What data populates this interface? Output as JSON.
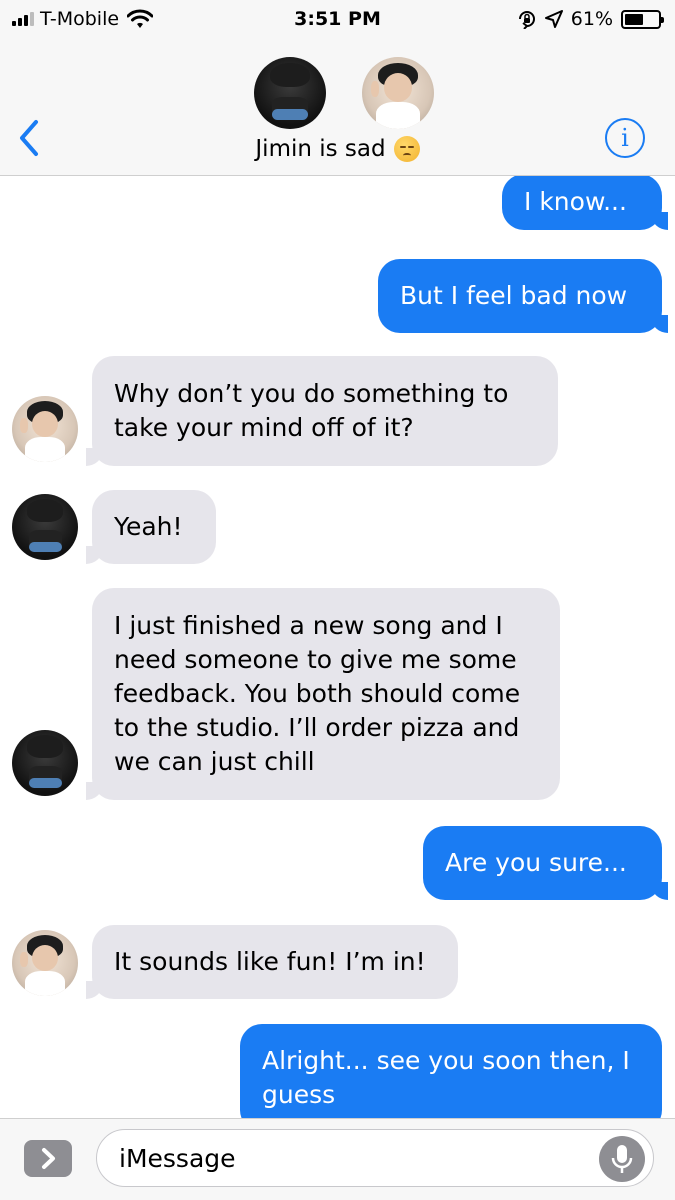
{
  "status_bar": {
    "carrier": "T-Mobile",
    "time": "3:51 PM",
    "battery": "61%",
    "battery_level": 0.61,
    "icons": [
      "signal-icon",
      "wifi-icon",
      "orientation-lock-icon",
      "location-icon",
      "battery-icon"
    ]
  },
  "header": {
    "group_name": "Jimin is sad",
    "emoji": "pensive-face-emoji",
    "back_icon": "chevron-left-icon",
    "info_icon": "info-icon"
  },
  "messages": [
    {
      "direction": "outgoing",
      "text": "I know..."
    },
    {
      "direction": "outgoing",
      "text": "But I feel bad now"
    },
    {
      "direction": "incoming",
      "sender_avatar": "avatar-b",
      "text": "Why don’t you do something to take your mind off of it?"
    },
    {
      "direction": "incoming",
      "sender_avatar": "avatar-a",
      "text": "Yeah!"
    },
    {
      "direction": "incoming",
      "sender_avatar": "avatar-a",
      "text": "I just finished a new song and I need someone to give me some feedback. You both should come to the studio. I’ll order pizza and we can just chill"
    },
    {
      "direction": "outgoing",
      "text": "Are you sure..."
    },
    {
      "direction": "incoming",
      "sender_avatar": "avatar-b",
      "text": "It sounds like fun! I’m in!"
    },
    {
      "direction": "outgoing",
      "text": "Alright... see you soon then, I guess"
    }
  ],
  "compose": {
    "placeholder": "iMessage",
    "apps_icon": "chevron-right-icon",
    "mic_icon": "microphone-icon"
  },
  "colors": {
    "accent": "#1a7cf3",
    "incoming_bubble": "#e6e5eb",
    "bar_background": "#f7f7f7"
  }
}
